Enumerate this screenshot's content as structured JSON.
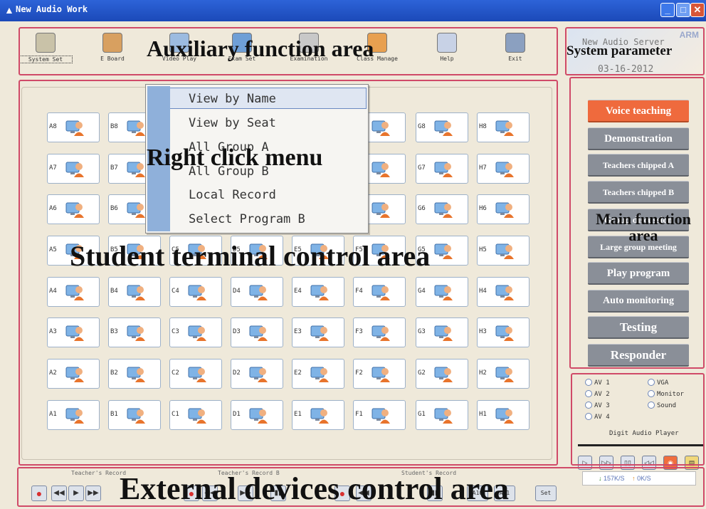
{
  "window": {
    "title": "New Audio Work"
  },
  "toolbar": {
    "items": [
      {
        "label": "System Set",
        "icon": "system-set-icon"
      },
      {
        "label": "E Board",
        "icon": "e-board-icon"
      },
      {
        "label": "Video Play",
        "icon": "video-play-icon"
      },
      {
        "label": "Exam Set",
        "icon": "exam-set-icon"
      },
      {
        "label": "Examination",
        "icon": "examination-icon"
      },
      {
        "label": "Class Manage",
        "icon": "class-manage-icon"
      },
      {
        "label": "Help",
        "icon": "help-icon"
      },
      {
        "label": "Exit",
        "icon": "exit-icon"
      }
    ]
  },
  "system_param": {
    "brand": "ARM",
    "server": "New Audio Server",
    "date": "03-16-2012"
  },
  "captions": {
    "auxiliary": "Auxiliary function area",
    "system_parameter": "System parameter",
    "right_click": "Right click menu",
    "student": "Student terminal control area",
    "main_function": "Main function area",
    "external": "External devices control area"
  },
  "context_menu": {
    "items": [
      "View by Name",
      "View by Seat",
      "All Group A",
      "All Group B",
      "Local Record",
      "Select Program B"
    ],
    "highlighted": 0
  },
  "students": {
    "columns": [
      "A",
      "B",
      "C",
      "D",
      "E",
      "F",
      "G",
      "H"
    ],
    "rows": [
      "8",
      "7",
      "6",
      "5",
      "4",
      "3",
      "2",
      "1"
    ]
  },
  "main_functions": [
    {
      "label": "Voice teaching",
      "active": true
    },
    {
      "label": "Demonstration"
    },
    {
      "label": "Teachers chipped A"
    },
    {
      "label": "Teachers chipped B"
    },
    {
      "label": "Group discussion"
    },
    {
      "label": "Large group meeting"
    },
    {
      "label": "Play program"
    },
    {
      "label": "Auto monitoring"
    },
    {
      "label": "Testing"
    },
    {
      "label": "Responder"
    }
  ],
  "av_sources": {
    "left": [
      "AV 1",
      "AV 2",
      "AV 3",
      "AV 4"
    ],
    "right": [
      "VGA",
      "Monitor",
      "Sound"
    ],
    "player_label": "Digit Audio Player"
  },
  "network": {
    "down": "157K/S",
    "up": "0K/S"
  },
  "bottom": {
    "teacher_record": "Teacher's Record",
    "teacher_record_b": "Teacher's Record B",
    "student_record": "Student's Record",
    "btn_a": "A10",
    "btn_b": "A11",
    "btn_c": "Set"
  },
  "colors": {
    "titlebar": "#1b49b8",
    "active_button": "#ef6a3d",
    "inactive_button": "#8a8f98",
    "callout": "#d04a68"
  }
}
